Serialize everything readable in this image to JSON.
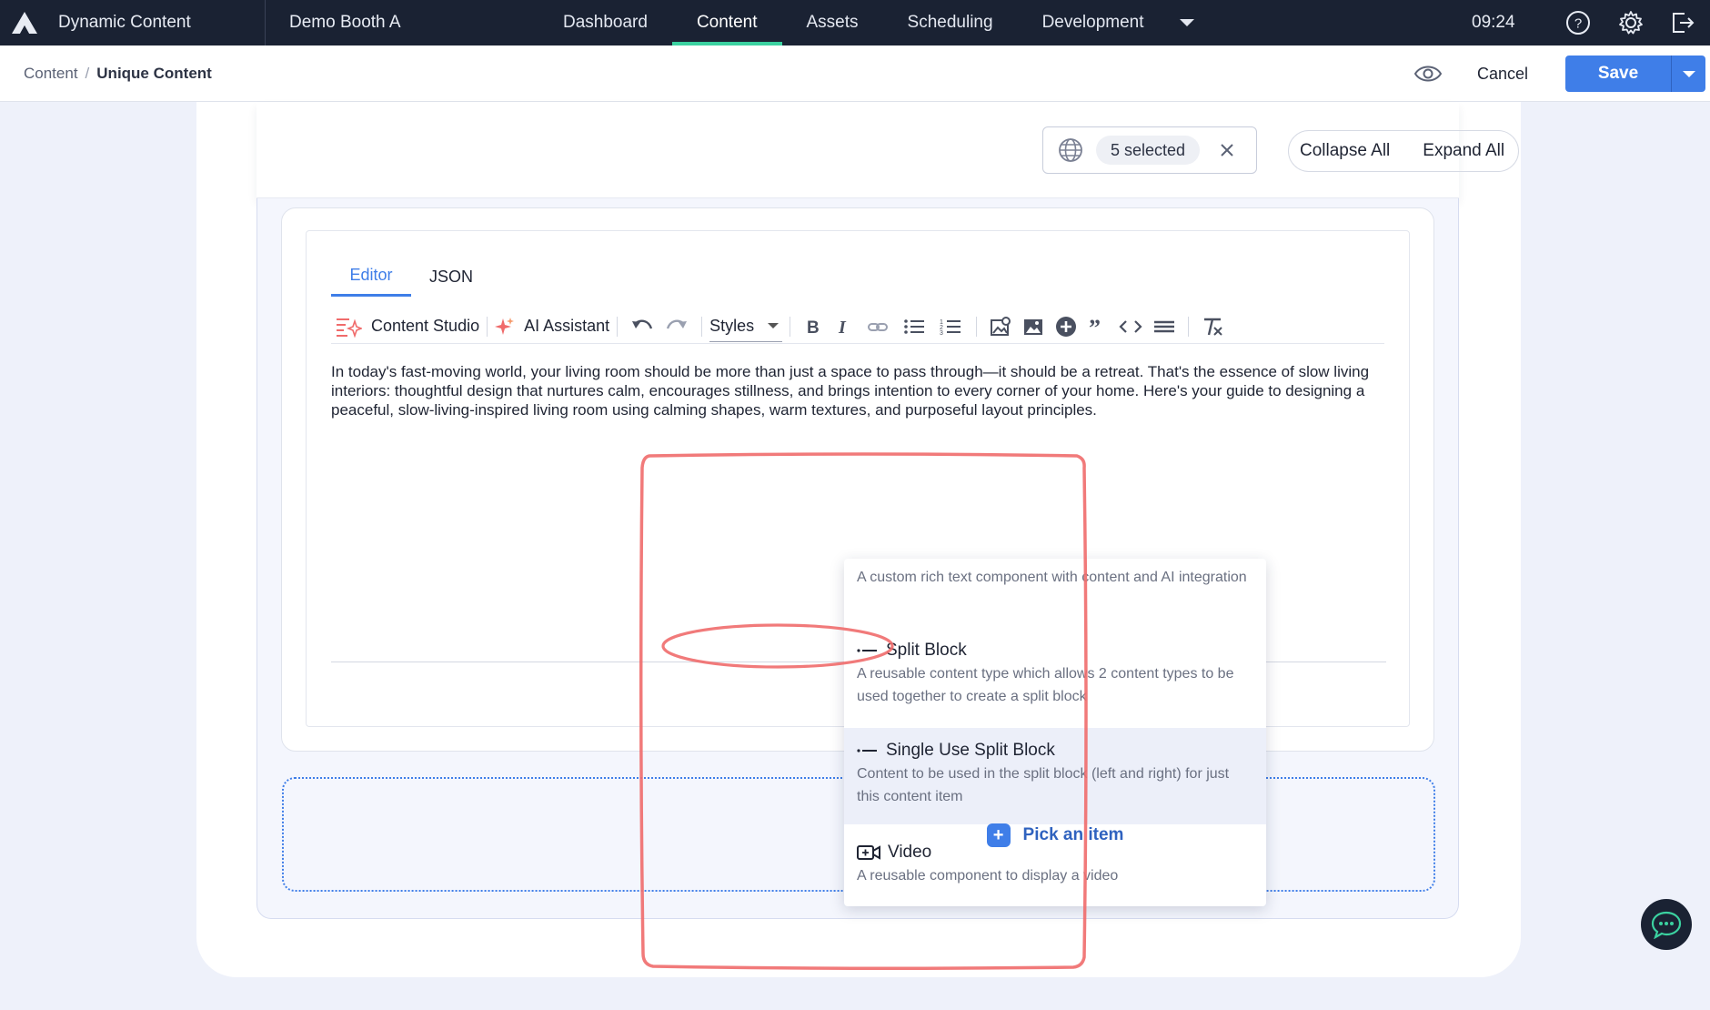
{
  "app": {
    "title": "Dynamic Content",
    "hub": "Demo Booth A"
  },
  "nav": {
    "items": [
      "Dashboard",
      "Content",
      "Assets",
      "Scheduling",
      "Development"
    ],
    "active": "Content"
  },
  "clock": "09:24",
  "breadcrumb": {
    "root": "Content",
    "separator": "/",
    "current": "Unique Content"
  },
  "actions": {
    "cancel": "Cancel",
    "save": "Save"
  },
  "locale": {
    "selected": "5 selected"
  },
  "panel": {
    "collapse_all": "Collapse All",
    "expand_all": "Expand All"
  },
  "editor": {
    "tabs": [
      "Editor",
      "JSON"
    ],
    "active_tab": "Editor",
    "toolbar": {
      "content_studio": "Content Studio",
      "ai_assistant": "AI Assistant",
      "styles": "Styles"
    },
    "body": "In today's fast-moving world, your living room should be more than just a space to pass through—it should be a retreat. That's the essence of slow living interiors: thoughtful design that nurtures calm, encourages stillness, and brings intention to every corner of your home.  Here's your guide to designing a peaceful, slow-living-inspired living room using calming shapes, warm textures, and purposeful layout principles."
  },
  "picker": {
    "options": [
      {
        "title": "",
        "description": "A custom rich text component with content and AI integration",
        "icon": "block-icon"
      },
      {
        "title": "Split Block",
        "description": "A reusable content type which allows 2 content types to be used together to create a split block",
        "icon": "split-icon"
      },
      {
        "title": "Single Use Split Block",
        "description": "Content to be used in the split block (left and right) for just this content item",
        "icon": "split-icon",
        "highlighted": true
      },
      {
        "title": "Video",
        "description": "A reusable component to display a video",
        "icon": "video-icon"
      }
    ],
    "pick_label": "Pick an item"
  },
  "colors": {
    "accent": "#3f7ee8",
    "nav_bg": "#1a2233",
    "nav_active": "#3bd1a0",
    "annotation": "#f06b6b"
  }
}
